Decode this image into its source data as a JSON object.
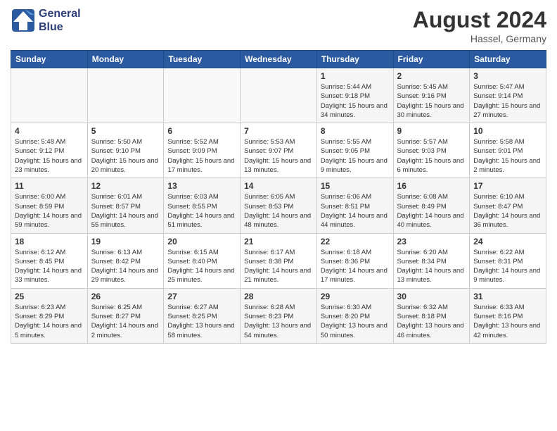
{
  "header": {
    "logo_line1": "General",
    "logo_line2": "Blue",
    "month_year": "August 2024",
    "location": "Hassel, Germany"
  },
  "days_of_week": [
    "Sunday",
    "Monday",
    "Tuesday",
    "Wednesday",
    "Thursday",
    "Friday",
    "Saturday"
  ],
  "weeks": [
    [
      {
        "day": "",
        "empty": true
      },
      {
        "day": "",
        "empty": true
      },
      {
        "day": "",
        "empty": true
      },
      {
        "day": "",
        "empty": true
      },
      {
        "day": "1",
        "sunrise": "5:44 AM",
        "sunset": "9:18 PM",
        "daylight": "15 hours and 34 minutes."
      },
      {
        "day": "2",
        "sunrise": "5:45 AM",
        "sunset": "9:16 PM",
        "daylight": "15 hours and 30 minutes."
      },
      {
        "day": "3",
        "sunrise": "5:47 AM",
        "sunset": "9:14 PM",
        "daylight": "15 hours and 27 minutes."
      }
    ],
    [
      {
        "day": "4",
        "sunrise": "5:48 AM",
        "sunset": "9:12 PM",
        "daylight": "15 hours and 23 minutes."
      },
      {
        "day": "5",
        "sunrise": "5:50 AM",
        "sunset": "9:10 PM",
        "daylight": "15 hours and 20 minutes."
      },
      {
        "day": "6",
        "sunrise": "5:52 AM",
        "sunset": "9:09 PM",
        "daylight": "15 hours and 17 minutes."
      },
      {
        "day": "7",
        "sunrise": "5:53 AM",
        "sunset": "9:07 PM",
        "daylight": "15 hours and 13 minutes."
      },
      {
        "day": "8",
        "sunrise": "5:55 AM",
        "sunset": "9:05 PM",
        "daylight": "15 hours and 9 minutes."
      },
      {
        "day": "9",
        "sunrise": "5:57 AM",
        "sunset": "9:03 PM",
        "daylight": "15 hours and 6 minutes."
      },
      {
        "day": "10",
        "sunrise": "5:58 AM",
        "sunset": "9:01 PM",
        "daylight": "15 hours and 2 minutes."
      }
    ],
    [
      {
        "day": "11",
        "sunrise": "6:00 AM",
        "sunset": "8:59 PM",
        "daylight": "14 hours and 59 minutes."
      },
      {
        "day": "12",
        "sunrise": "6:01 AM",
        "sunset": "8:57 PM",
        "daylight": "14 hours and 55 minutes."
      },
      {
        "day": "13",
        "sunrise": "6:03 AM",
        "sunset": "8:55 PM",
        "daylight": "14 hours and 51 minutes."
      },
      {
        "day": "14",
        "sunrise": "6:05 AM",
        "sunset": "8:53 PM",
        "daylight": "14 hours and 48 minutes."
      },
      {
        "day": "15",
        "sunrise": "6:06 AM",
        "sunset": "8:51 PM",
        "daylight": "14 hours and 44 minutes."
      },
      {
        "day": "16",
        "sunrise": "6:08 AM",
        "sunset": "8:49 PM",
        "daylight": "14 hours and 40 minutes."
      },
      {
        "day": "17",
        "sunrise": "6:10 AM",
        "sunset": "8:47 PM",
        "daylight": "14 hours and 36 minutes."
      }
    ],
    [
      {
        "day": "18",
        "sunrise": "6:12 AM",
        "sunset": "8:45 PM",
        "daylight": "14 hours and 33 minutes."
      },
      {
        "day": "19",
        "sunrise": "6:13 AM",
        "sunset": "8:42 PM",
        "daylight": "14 hours and 29 minutes."
      },
      {
        "day": "20",
        "sunrise": "6:15 AM",
        "sunset": "8:40 PM",
        "daylight": "14 hours and 25 minutes."
      },
      {
        "day": "21",
        "sunrise": "6:17 AM",
        "sunset": "8:38 PM",
        "daylight": "14 hours and 21 minutes."
      },
      {
        "day": "22",
        "sunrise": "6:18 AM",
        "sunset": "8:36 PM",
        "daylight": "14 hours and 17 minutes."
      },
      {
        "day": "23",
        "sunrise": "6:20 AM",
        "sunset": "8:34 PM",
        "daylight": "14 hours and 13 minutes."
      },
      {
        "day": "24",
        "sunrise": "6:22 AM",
        "sunset": "8:31 PM",
        "daylight": "14 hours and 9 minutes."
      }
    ],
    [
      {
        "day": "25",
        "sunrise": "6:23 AM",
        "sunset": "8:29 PM",
        "daylight": "14 hours and 5 minutes."
      },
      {
        "day": "26",
        "sunrise": "6:25 AM",
        "sunset": "8:27 PM",
        "daylight": "14 hours and 2 minutes."
      },
      {
        "day": "27",
        "sunrise": "6:27 AM",
        "sunset": "8:25 PM",
        "daylight": "13 hours and 58 minutes."
      },
      {
        "day": "28",
        "sunrise": "6:28 AM",
        "sunset": "8:23 PM",
        "daylight": "13 hours and 54 minutes."
      },
      {
        "day": "29",
        "sunrise": "6:30 AM",
        "sunset": "8:20 PM",
        "daylight": "13 hours and 50 minutes."
      },
      {
        "day": "30",
        "sunrise": "6:32 AM",
        "sunset": "8:18 PM",
        "daylight": "13 hours and 46 minutes."
      },
      {
        "day": "31",
        "sunrise": "6:33 AM",
        "sunset": "8:16 PM",
        "daylight": "13 hours and 42 minutes."
      }
    ]
  ],
  "labels": {
    "sunrise": "Sunrise:",
    "sunset": "Sunset:",
    "daylight": "Daylight:"
  }
}
